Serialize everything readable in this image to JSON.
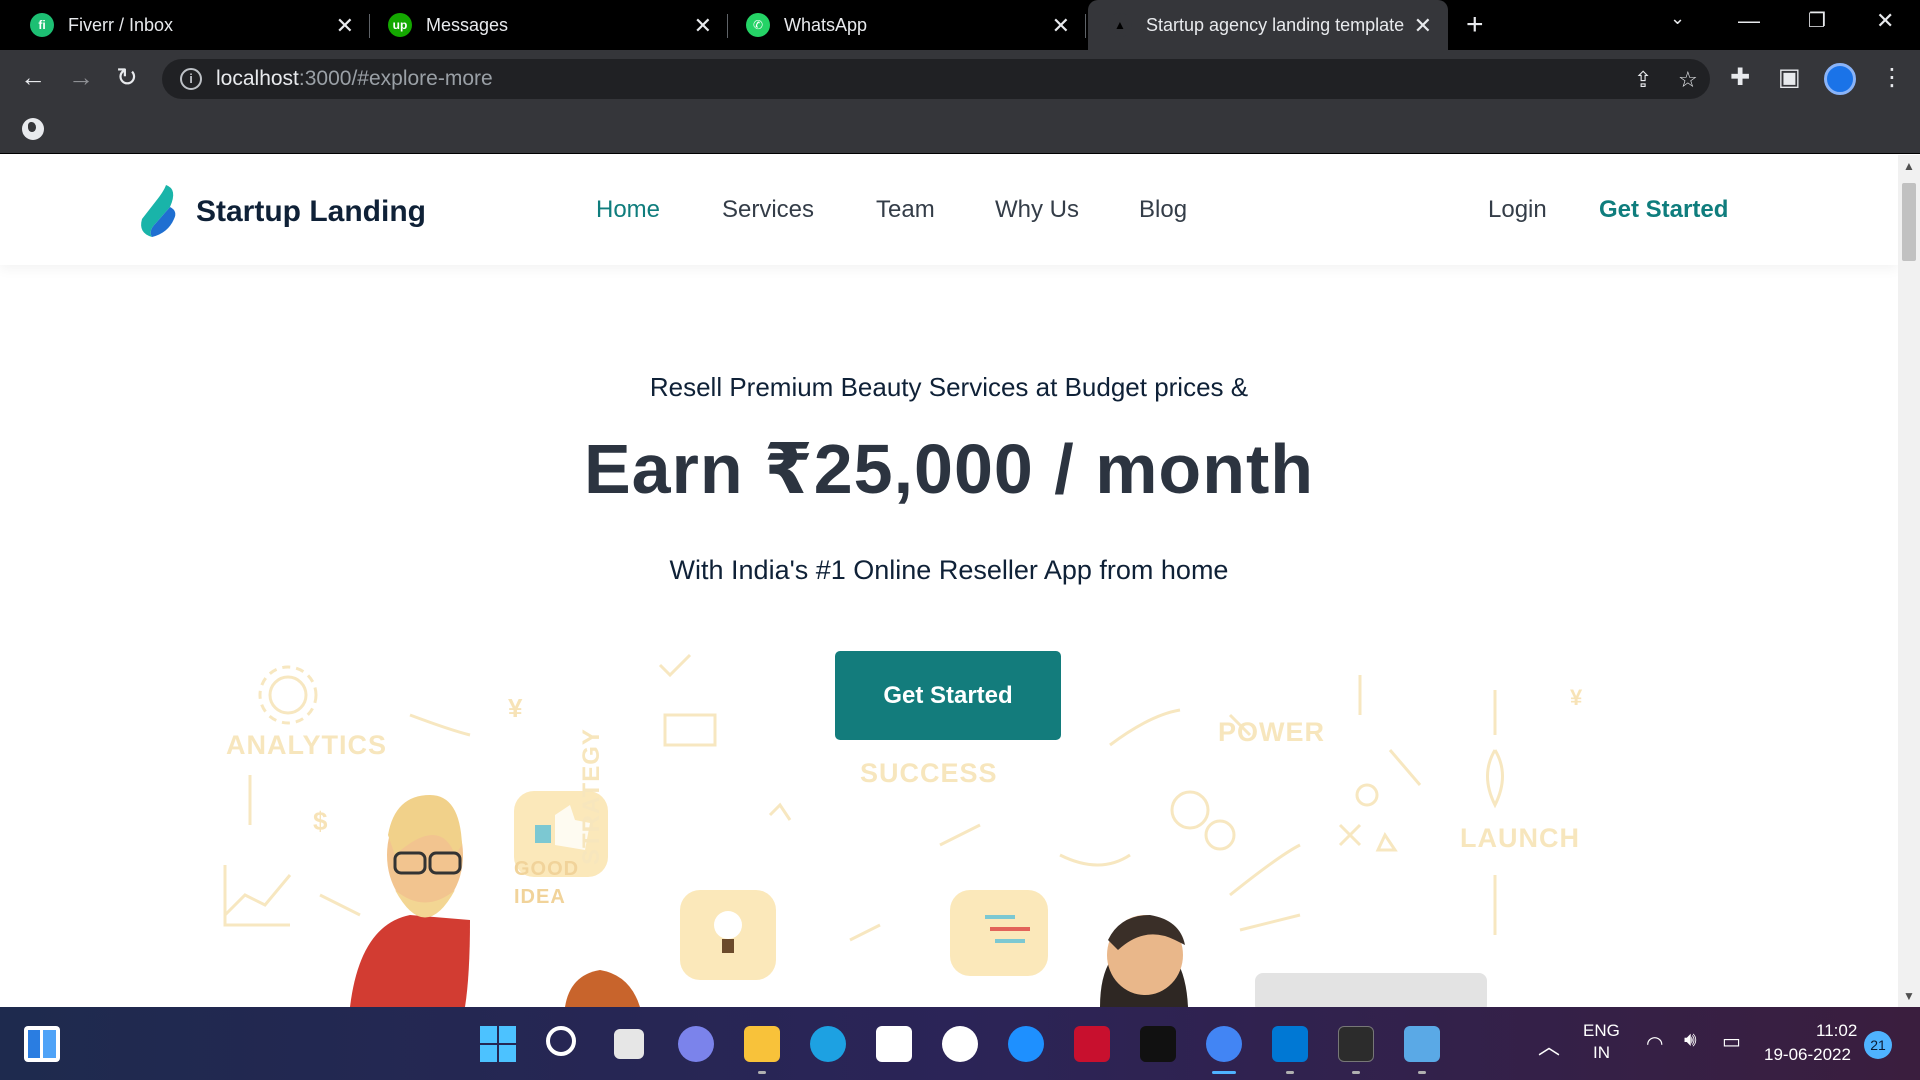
{
  "browser": {
    "tabs": [
      {
        "title": "Fiverr / Inbox",
        "icon": "fiverr-icon",
        "color": "#1dbf73",
        "active": false
      },
      {
        "title": "Messages",
        "icon": "upwork-icon",
        "color": "#14a800",
        "active": false
      },
      {
        "title": "WhatsApp",
        "icon": "whatsapp-icon",
        "color": "#25d366",
        "active": false
      },
      {
        "title": "Startup agency landing template",
        "icon": "page-icon",
        "color": "#202124",
        "active": true
      }
    ],
    "url_host": "localhost",
    "url_path": ":3000/#explore-more"
  },
  "site": {
    "brand": "Startup Landing",
    "nav": [
      "Home",
      "Services",
      "Team",
      "Why Us",
      "Blog"
    ],
    "login": "Login",
    "header_cta": "Get Started",
    "accent_color": "#137c7c"
  },
  "hero": {
    "subtitle": "Resell Premium Beauty Services at Budget prices &",
    "title": "Earn ₹25,000 / month",
    "tagline": "With India's #1 Online Reseller App from home",
    "cta": "Get Started"
  },
  "illustration": {
    "words": [
      "ANALYTICS",
      "SUCCESS",
      "POWER",
      "LAUNCH",
      "STRATEGY",
      "GOOD IDEA"
    ]
  },
  "taskbar": {
    "language": "ENG",
    "region": "IN",
    "time": "11:02",
    "date": "19-06-2022",
    "notifications": "21"
  }
}
